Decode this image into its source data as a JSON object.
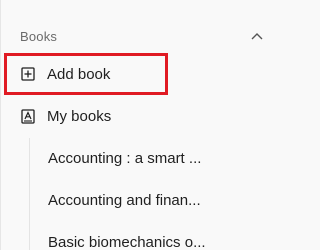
{
  "section": {
    "title": "Books",
    "chevron_icon": "chevron-up-icon"
  },
  "nav": {
    "add_book": {
      "label": "Add book",
      "icon": "add-book-icon"
    },
    "my_books": {
      "label": "My books",
      "icon": "book-icon"
    }
  },
  "books": [
    {
      "title": "Accounting : a smart ..."
    },
    {
      "title": "Accounting and finan..."
    },
    {
      "title": "Basic biomechanics o..."
    }
  ],
  "colors": {
    "highlight": "#e01b24",
    "background": "#f9f9f9"
  }
}
